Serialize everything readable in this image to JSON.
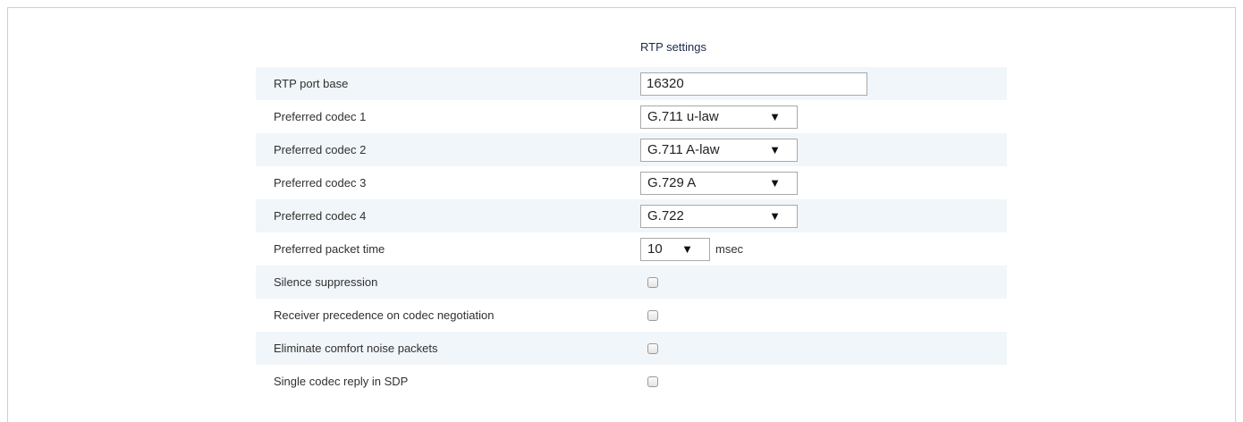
{
  "section": {
    "title": "RTP settings"
  },
  "fields": {
    "rtp_port_base": {
      "label": "RTP port base",
      "value": "16320"
    },
    "codec1": {
      "label": "Preferred codec 1",
      "value": "G.711 u-law"
    },
    "codec2": {
      "label": "Preferred codec 2",
      "value": "G.711 A-law"
    },
    "codec3": {
      "label": "Preferred codec 3",
      "value": "G.729 A"
    },
    "codec4": {
      "label": "Preferred codec 4",
      "value": "G.722"
    },
    "packet_time": {
      "label": "Preferred packet time",
      "value": "10",
      "unit": "msec"
    },
    "silence_suppression": {
      "label": "Silence suppression",
      "checked": false
    },
    "receiver_precedence": {
      "label": "Receiver precedence on codec negotiation",
      "checked": false
    },
    "eliminate_cn": {
      "label": "Eliminate comfort noise packets",
      "checked": false
    },
    "single_codec_reply": {
      "label": "Single codec reply in SDP",
      "checked": false
    }
  },
  "icons": {
    "dropdown_arrow": "▼"
  }
}
